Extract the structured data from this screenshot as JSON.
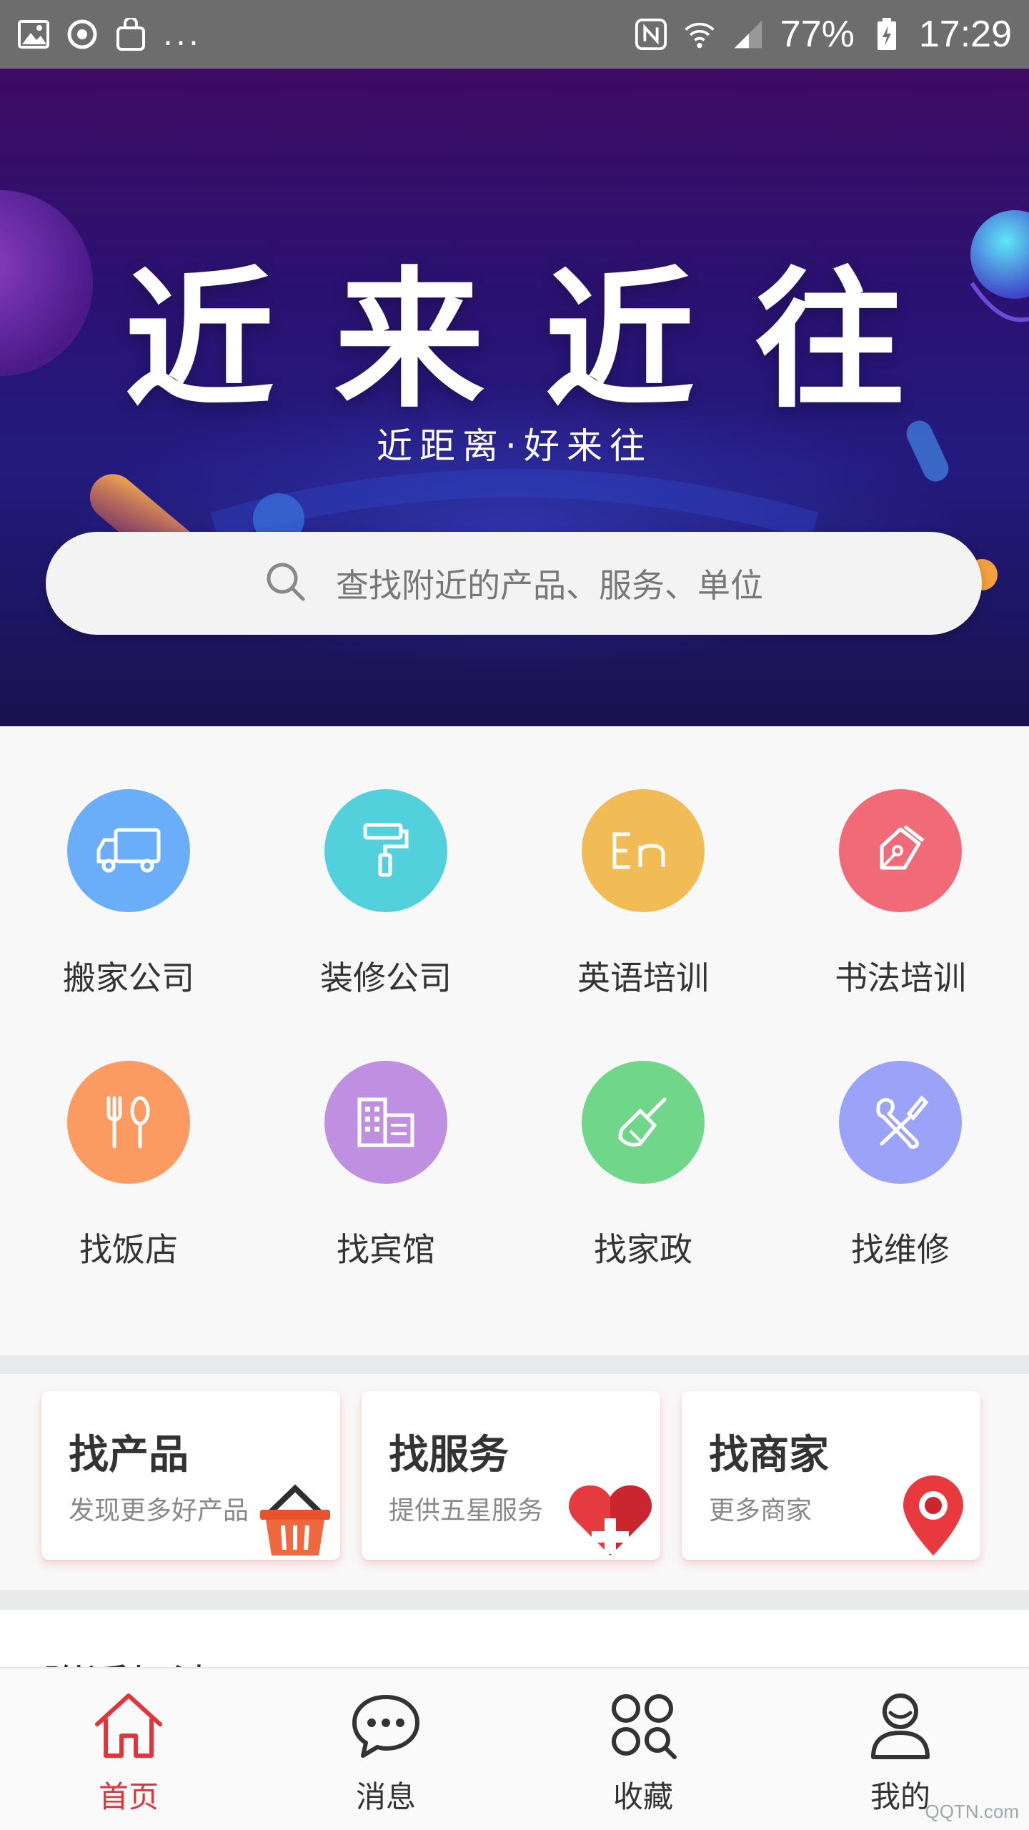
{
  "status_bar": {
    "left_icons": [
      "image-icon",
      "sync-icon",
      "bag-icon"
    ],
    "more": "...",
    "right_icons": [
      "nfc-icon",
      "wifi-icon",
      "signal-icon"
    ],
    "battery": "77%",
    "time": "17:29"
  },
  "banner": {
    "title": "近来近往",
    "subtitle": "近距离·好来往",
    "search_placeholder": "查找附近的产品、服务、单位"
  },
  "categories": [
    {
      "label": "搬家公司",
      "icon": "truck-icon",
      "color": "#6aaef9"
    },
    {
      "label": "装修公司",
      "icon": "paint-roller-icon",
      "color": "#52d0dc"
    },
    {
      "label": "英语培训",
      "icon": "en-icon",
      "color": "#f1bb56"
    },
    {
      "label": "书法培训",
      "icon": "pen-nib-icon",
      "color": "#f16a78"
    },
    {
      "label": "找饭店",
      "icon": "fork-spoon-icon",
      "color": "#fb9a61"
    },
    {
      "label": "找宾馆",
      "icon": "hotel-icon",
      "color": "#bf8fe2"
    },
    {
      "label": "找家政",
      "icon": "broom-icon",
      "color": "#6fd68a"
    },
    {
      "label": "找维修",
      "icon": "tools-icon",
      "color": "#9aa3f7"
    }
  ],
  "cards": [
    {
      "title": "找产品",
      "subtitle": "发现更多好产品",
      "icon": "basket-icon"
    },
    {
      "title": "找服务",
      "subtitle": "提供五星服务",
      "icon": "heart-plus-icon"
    },
    {
      "title": "找商家",
      "subtitle": "更多商家",
      "icon": "location-pin-icon"
    }
  ],
  "nearby_title": "附近加油",
  "nav": [
    {
      "label": "首页",
      "icon": "home-icon",
      "active": true
    },
    {
      "label": "消息",
      "icon": "message-icon",
      "active": false
    },
    {
      "label": "收藏",
      "icon": "collect-icon",
      "active": false
    },
    {
      "label": "我的",
      "icon": "user-icon",
      "active": false
    }
  ],
  "colors": {
    "accent": "#e0353a",
    "banner_dark": "#231a7e"
  },
  "watermark": "QQTN.com"
}
